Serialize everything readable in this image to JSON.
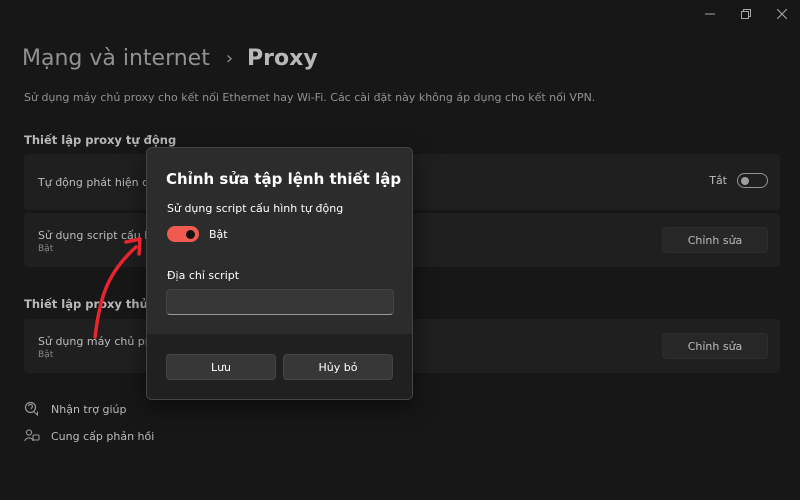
{
  "window": {
    "controls": [
      "minimize",
      "maximize",
      "close"
    ]
  },
  "breadcrumb": {
    "parent": "Mạng và internet",
    "separator": "›",
    "current": "Proxy"
  },
  "description": "Sử dụng máy chủ proxy cho kết nối Ethernet hay Wi-Fi. Các cài đặt này không áp dụng cho kết nối VPN.",
  "auto_section": {
    "title": "Thiết lập proxy tự động",
    "detect": {
      "label": "Tự động phát hiện các",
      "toggle_text": "Tắt",
      "toggle_on": false
    },
    "script": {
      "label": "Sử dụng script cấu hì",
      "status": "Bật",
      "button": "Chỉnh sửa"
    }
  },
  "manual_section": {
    "title": "Thiết lập proxy thủ công",
    "server": {
      "label": "Sử dụng máy chủ pro",
      "status": "Bật",
      "button": "Chỉnh sửa"
    }
  },
  "links": {
    "help": "Nhận trợ giúp",
    "feedback": "Cung cấp phản hồi"
  },
  "dialog": {
    "title": "Chỉnh sửa tập lệnh thiết lập",
    "toggle_label": "Sử dụng script cấu hình tự động",
    "toggle_text": "Bật",
    "toggle_on": true,
    "address_label": "Địa chỉ script",
    "address_value": "",
    "save": "Lưu",
    "cancel": "Hủy bỏ"
  },
  "colors": {
    "accent": "#f05a4f",
    "background": "#202020",
    "card": "#2b2b2b",
    "arrow": "#e8242e"
  }
}
